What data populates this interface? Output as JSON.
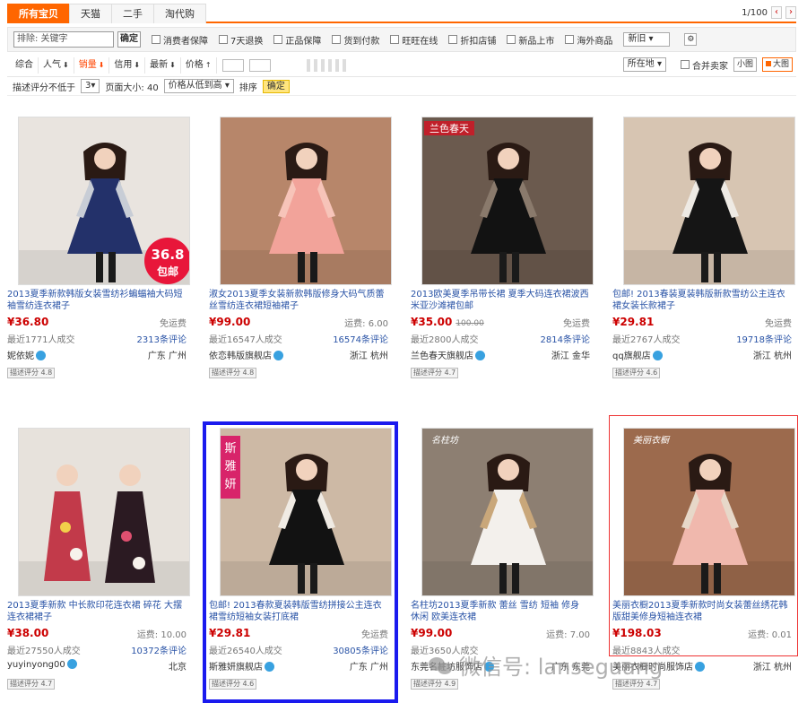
{
  "tabs": [
    "所有宝贝",
    "天猫",
    "二手",
    "淘代购"
  ],
  "pager": {
    "text": "1/100",
    "prev": "‹",
    "next": "›"
  },
  "filters": {
    "search_value": "排除: 关键字",
    "search_btn": "确定",
    "checks": [
      "消费者保障",
      "7天退换",
      "正品保障",
      "货到付款",
      "旺旺在线",
      "折扣店铺",
      "新品上市",
      "海外商品"
    ],
    "select_label": "新旧",
    "extra_icon": "settings-icon"
  },
  "sort": {
    "items": [
      "综合",
      "人气",
      "销量",
      "信用",
      "最新",
      "价格"
    ],
    "active_index": 2,
    "location": "所在地",
    "merge": "合并卖家",
    "view_small": "小图",
    "view_large": "大图"
  },
  "options": {
    "label1": "描述评分不低于",
    "value1": "3",
    "label2": "页面大小: 40",
    "dropdown": "价格从低到高",
    "label3": "排序",
    "confirm": "确定"
  },
  "colors": {
    "accent": "#ff6600",
    "price": "#cc0000",
    "link": "#2953a6",
    "selected_blue": "#1a1aee",
    "selected_red": "#ee3333"
  },
  "products": [
    {
      "title": "2013夏季新款韩版女装雪纺衫蝙蝠袖大码短袖雪纺连衣裙子",
      "price": "36.80",
      "old": "",
      "ship": "免运费",
      "sales": "最近1771人成交",
      "reviews": "2313条评论",
      "shop": "妮依妮",
      "loc": "广东 广州",
      "dsr": "描述评分 4.8",
      "img": {
        "bg": "#e9e4df",
        "dress": "#23316a",
        "accent": "#c8cdd6",
        "tag": "36.8 包邮"
      }
    },
    {
      "title": "淑女2013夏季女装新款韩版修身大码气质蕾丝雪纺连衣裙短袖裙子",
      "price": "99.00",
      "old": "",
      "ship": "运费: 6.00",
      "sales": "最近16547人成交",
      "reviews": "16574条评论",
      "shop": "依恋韩版旗舰店",
      "loc": "浙江 杭州",
      "dsr": "描述评分 4.8",
      "img": {
        "bg": "#b7866a",
        "dress": "#f2a39a",
        "accent": "#f7c4b9",
        "tag": ""
      }
    },
    {
      "title": "2013欧美夏季吊带长裙 夏季大码连衣裙波西米亚沙滩裙包邮",
      "price": "35.00",
      "old": "100.00",
      "ship": "免运费",
      "sales": "最近2800人成交",
      "reviews": "2814条评论",
      "shop": "兰色春天旗舰店",
      "loc": "浙江 金华",
      "dsr": "描述评分 4.7",
      "img": {
        "bg": "#6b5a4e",
        "dress": "#121212",
        "accent": "#8a7a6c",
        "tag": "兰色春天"
      }
    },
    {
      "title": "包邮! 2013春装夏装韩版新款雪纺公主连衣裙女装长款裙子",
      "price": "29.81",
      "old": "",
      "ship": "免运费",
      "sales": "最近2767人成交",
      "reviews": "19718条评论",
      "shop": "qq旗舰店",
      "loc": "浙江 杭州",
      "dsr": "描述评分 4.6",
      "img": {
        "bg": "#d7c5b2",
        "dress": "#151515",
        "accent": "#eeeae4",
        "tag": ""
      }
    },
    {
      "title": "2013夏季新款 中长款印花连衣裙 碎花 大摆连衣裙裙子",
      "price": "38.00",
      "old": "",
      "ship": "运费: 10.00",
      "sales": "最近27550人成交",
      "reviews": "10372条评论",
      "shop": "yuyinyong00",
      "loc": "北京",
      "dsr": "描述评分 4.7",
      "img": {
        "bg": "#e7e2dc",
        "dress": "#c23a4a",
        "accent": "#2b1a22",
        "tag": ""
      }
    },
    {
      "title": "包邮! 2013春款夏装韩版雪纺拼接公主连衣裙雪纺短袖女装打底裙",
      "price": "29.81",
      "old": "",
      "ship": "免运费",
      "sales": "最近26540人成交",
      "reviews": "30805条评论",
      "shop": "斯雅妍旗舰店",
      "loc": "广东 广州",
      "dsr": "描述评分 4.6",
      "img": {
        "bg": "#cdb9a5",
        "dress": "#121212",
        "accent": "#f0ebe4",
        "tag": "斯雅妍"
      }
    },
    {
      "title": "名柱坊2013夏季新款 蕾丝 雪纺 短袖 修身 休闲 欧美连衣裙",
      "price": "99.00",
      "old": "",
      "ship": "运费: 7.00",
      "sales": "最近3650人成交",
      "reviews": "",
      "shop": "东莞名柱坊服饰店",
      "loc": "广东 东莞",
      "dsr": "描述评分 4.9",
      "img": {
        "bg": "#8d7f72",
        "dress": "#f3f0ec",
        "accent": "#c9a77a",
        "tag": "名柱坊"
      }
    },
    {
      "title": "美丽衣橱2013夏季新款时尚女装蕾丝绣花韩版甜美修身短袖连衣裙",
      "price": "198.03",
      "old": "",
      "ship": "运费: 0.01",
      "sales": "最近8843人成交",
      "reviews": "",
      "shop": "美丽衣橱时尚服饰店",
      "loc": "浙江 杭州",
      "dsr": "描述评分 4.7",
      "img": {
        "bg": "#9c6a4d",
        "dress": "#f0b8ad",
        "accent": "#e7d8c9",
        "tag": "美丽衣橱"
      }
    }
  ],
  "watermark": "微信号: lanseguang"
}
